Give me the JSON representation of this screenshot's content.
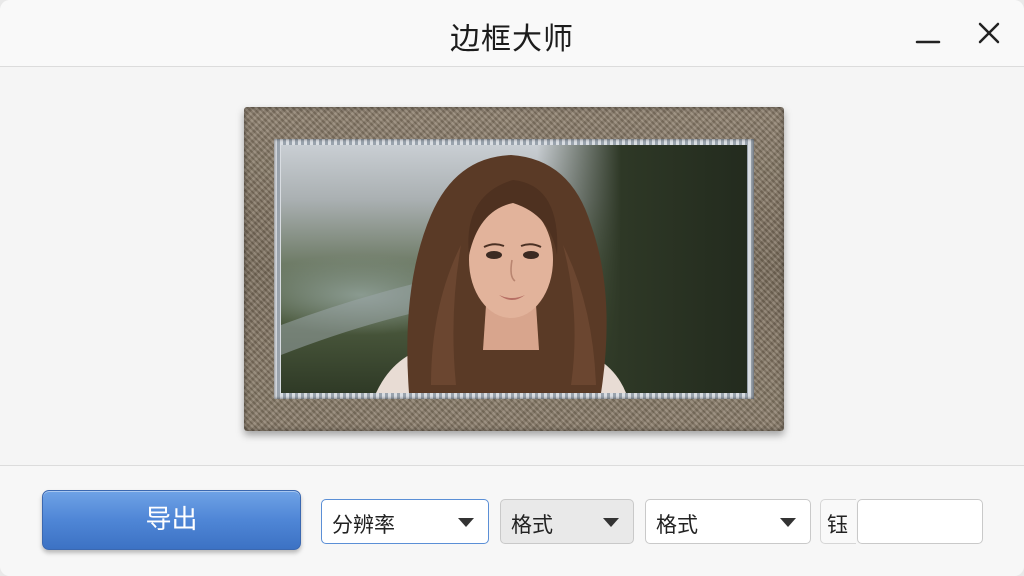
{
  "window": {
    "title": "边框大师",
    "controls": {
      "minimize_icon": "minimize-icon",
      "close_icon": "close-icon"
    }
  },
  "preview": {
    "frame_style": "rustic-textured-wood",
    "photo_subject": "portrait-photo"
  },
  "toolbar": {
    "export_label": "导出",
    "resolution_select": "分辨率",
    "format_select_1": "格式",
    "format_select_2": "格式",
    "field_label": "钰",
    "text_input_value": ""
  },
  "colors": {
    "accent": "#4f86d6",
    "window_bg": "#f6f6f6",
    "frame": "#847663"
  }
}
